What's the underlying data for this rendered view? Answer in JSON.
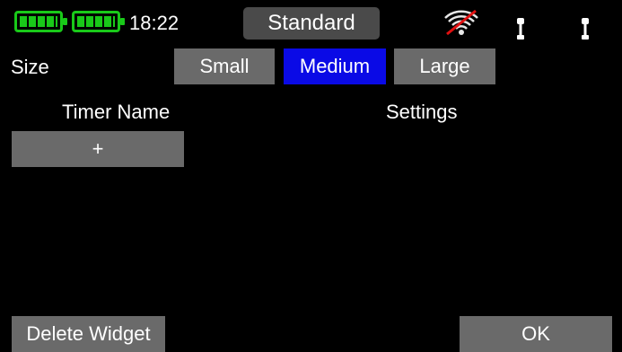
{
  "status_bar": {
    "time": "18:22",
    "mode_button": "Standard"
  },
  "size": {
    "label": "Size",
    "options": [
      "Small",
      "Medium",
      "Large"
    ],
    "selected": "Medium"
  },
  "table": {
    "headers": [
      "Timer Name",
      "Settings"
    ],
    "add_label": "+"
  },
  "footer": {
    "delete_label": "Delete Widget",
    "ok_label": "OK"
  },
  "colors": {
    "battery": "#19c919",
    "selected": "#0a0ae6",
    "button": "#6a6a6a"
  }
}
